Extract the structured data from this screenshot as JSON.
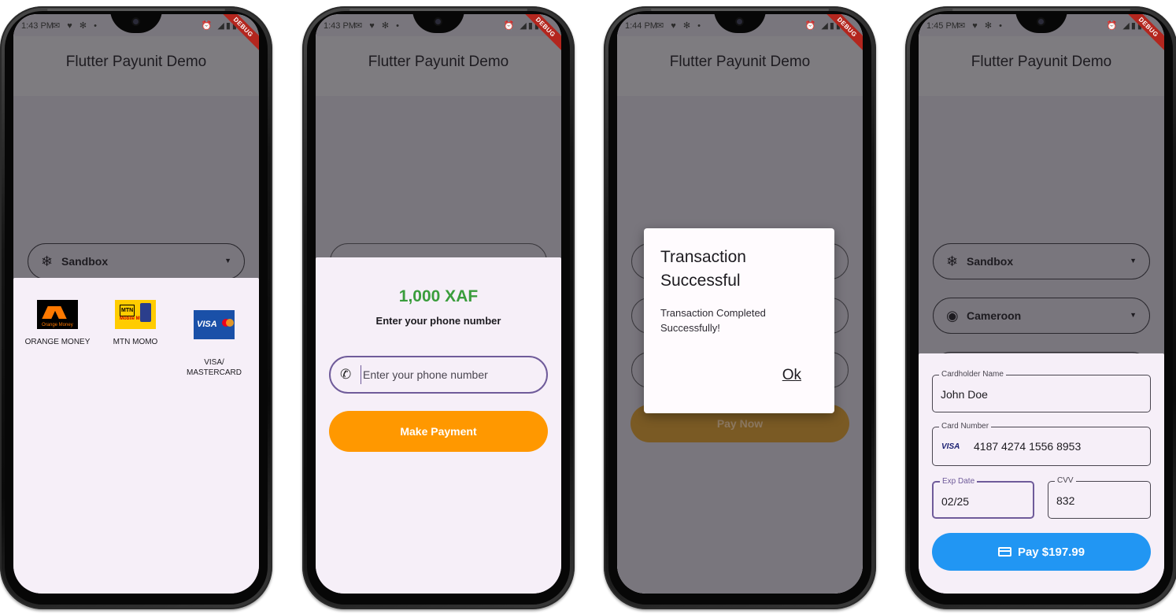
{
  "common": {
    "app_title": "Flutter Payunit Demo",
    "debug_label": "DEBUG",
    "status_icons_left": "✉ ♥ ✻ •",
    "status_icons_right": "⏰ ◢▮▮"
  },
  "screen1": {
    "time": "1:43 PM",
    "environment_dropdown": "Sandbox",
    "payment_methods": [
      {
        "label": "ORANGE MONEY",
        "icon": "orange-money-logo"
      },
      {
        "label": "MTN MOMO",
        "icon": "mtn-momo-logo"
      },
      {
        "label": "VISA/\nMASTERCARD",
        "icon": "visa-mastercard-logo"
      }
    ]
  },
  "screen2": {
    "time": "1:43 PM",
    "amount": "1,000 XAF",
    "subtitle": "Enter your phone number",
    "phone_placeholder": "Enter your phone number",
    "submit_label": "Make Payment"
  },
  "screen3": {
    "time": "1:44 PM",
    "dialog_title": "Transaction Successful",
    "dialog_message": "Transaction Completed Successfully!",
    "dialog_ok": "Ok",
    "background_button": "Pay Now"
  },
  "screen4": {
    "time": "1:45 PM",
    "environment_dropdown": "Sandbox",
    "country_dropdown": "Cameroon",
    "cardholder_label": "Cardholder Name",
    "cardholder_value": "John Doe",
    "card_number_label": "Card Number",
    "card_brand": "VISA",
    "card_number_value": "4187 4274 1556 8953",
    "exp_label": "Exp Date",
    "exp_value": "02/25",
    "cvv_label": "CVV",
    "cvv_value": "832",
    "pay_label": "Pay $197.99"
  },
  "colors": {
    "amount_green": "#3a9d3c",
    "orange_button": "#ff9800",
    "blue_button": "#2196f3",
    "focus_purple": "#6f5b9a"
  }
}
